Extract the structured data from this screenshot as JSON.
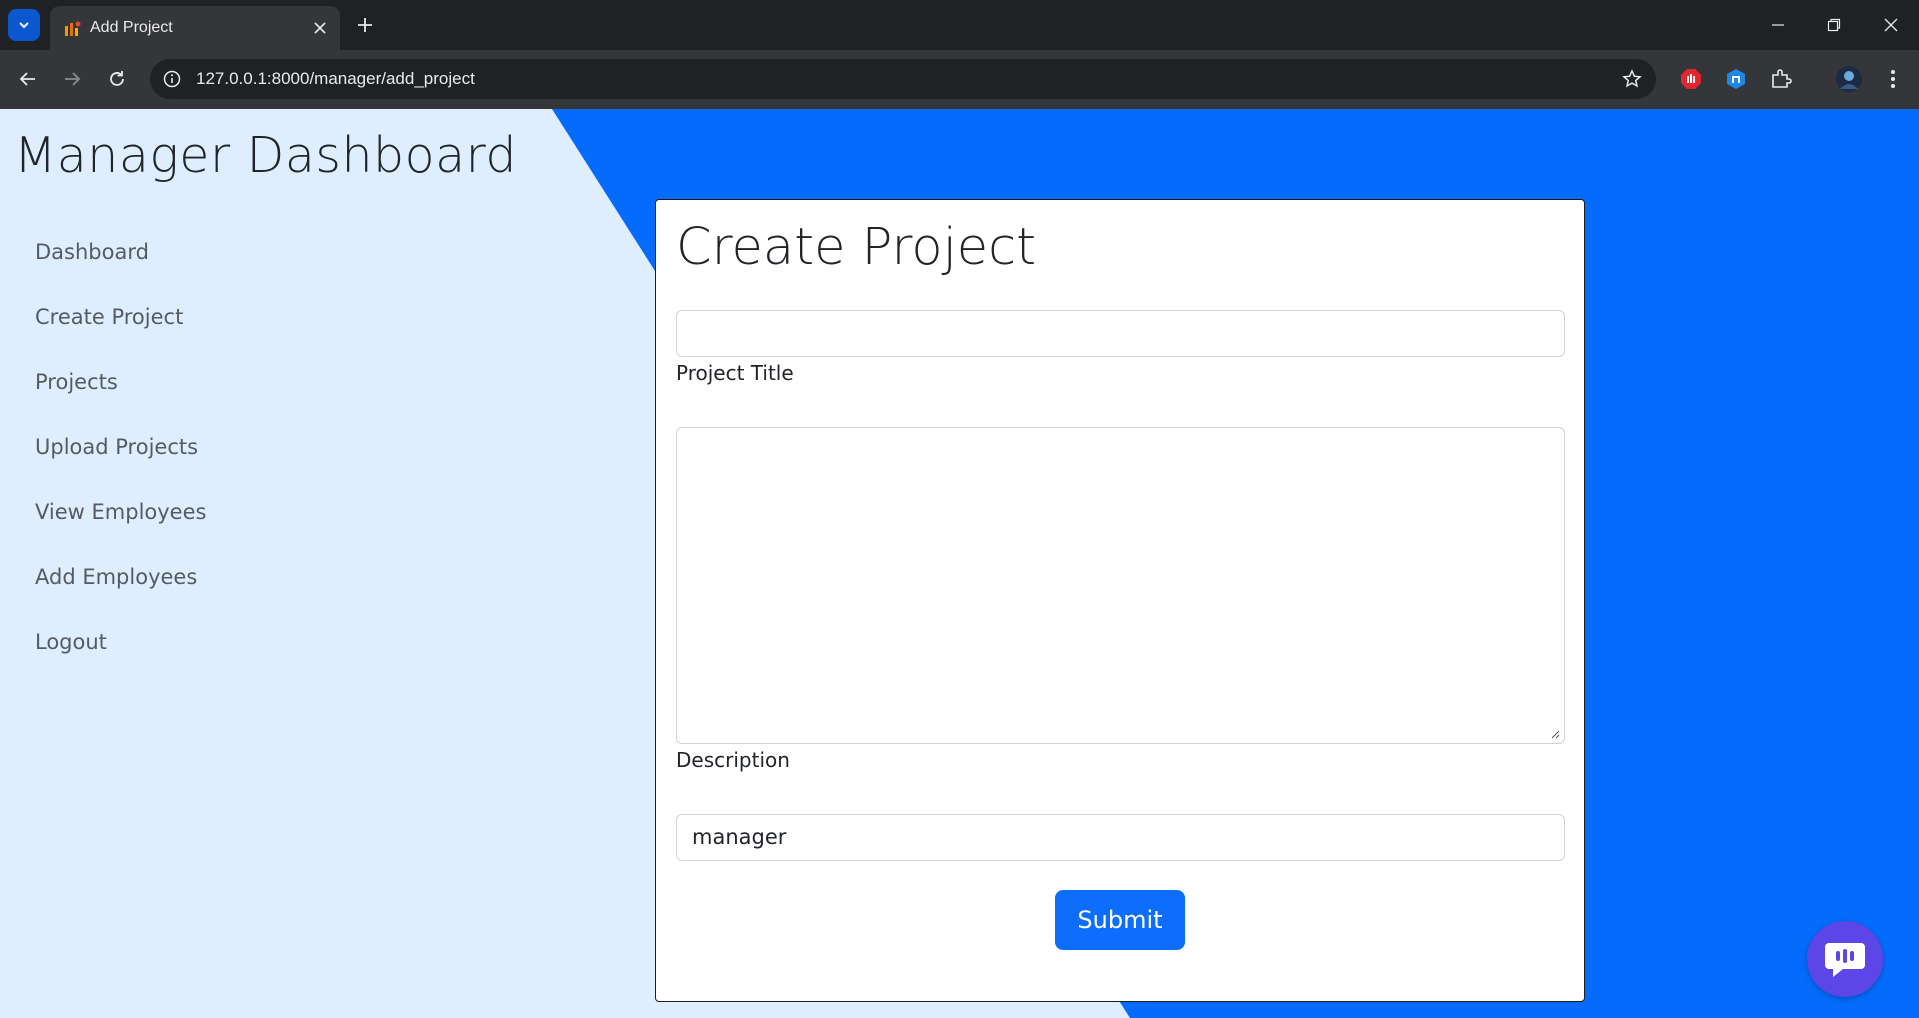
{
  "browser": {
    "tab_title": "Add Project",
    "url": "127.0.0.1:8000/manager/add_project",
    "icons": [
      "tab-search-icon",
      "favicon-icon",
      "close-icon",
      "plus-icon",
      "minimize-icon",
      "restore-icon",
      "close-window-icon",
      "back-icon",
      "forward-icon",
      "reload-icon",
      "site-info-icon",
      "star-icon",
      "adblock-extension-icon",
      "extension-icon",
      "puzzle-icon",
      "profile-avatar-icon",
      "kebab-menu-icon"
    ]
  },
  "sidebar": {
    "title": "Manager Dashboard",
    "items": [
      {
        "label": "Dashboard"
      },
      {
        "label": "Create Project"
      },
      {
        "label": "Projects"
      },
      {
        "label": "Upload Projects"
      },
      {
        "label": "View Employees"
      },
      {
        "label": "Add Employees"
      },
      {
        "label": "Logout"
      }
    ]
  },
  "form": {
    "heading": "Create Project",
    "title_label": "Project Title",
    "title_value": "",
    "description_label": "Description",
    "description_value": "",
    "manager_value": "manager",
    "submit_label": "Submit"
  },
  "colors": {
    "accent": "#0d6efd",
    "background_light": "#dfeeff",
    "background_blue": "#056bfd",
    "chat_button": "#5c46e8"
  }
}
